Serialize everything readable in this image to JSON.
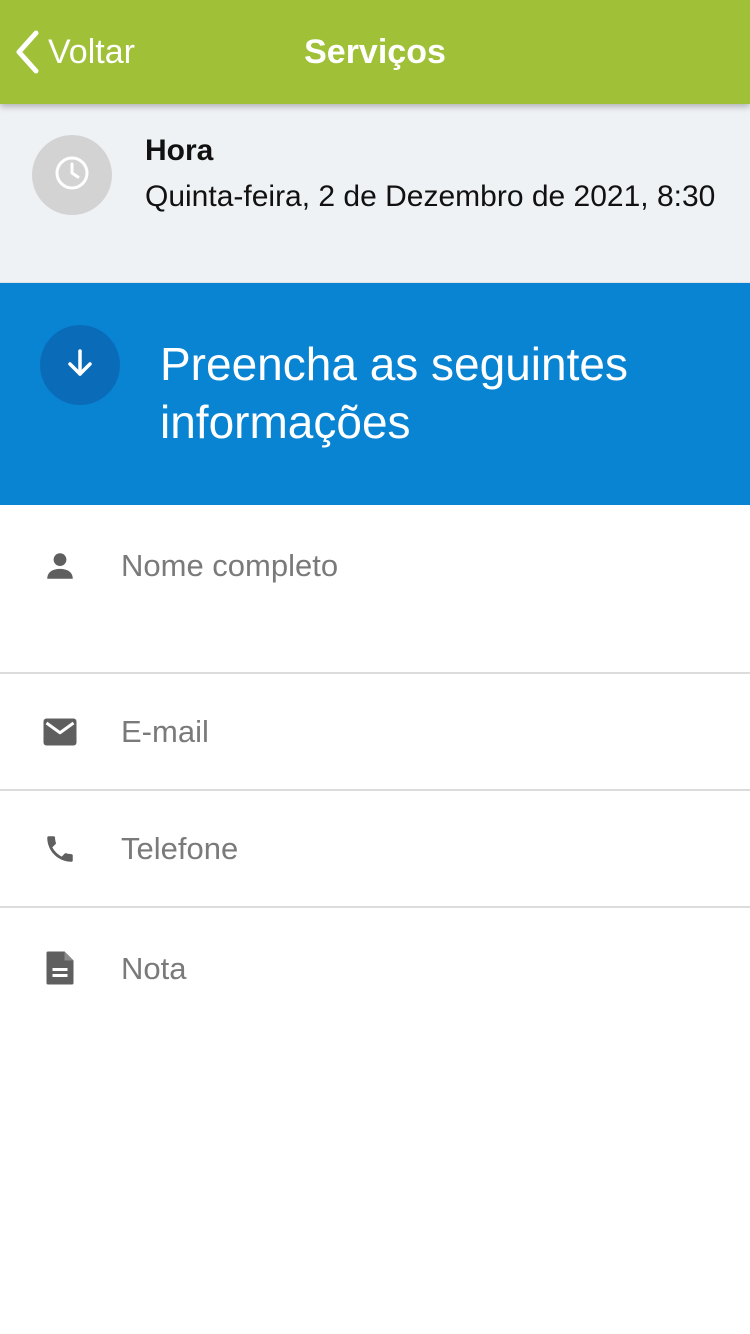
{
  "navbar": {
    "back_label": "Voltar",
    "title": "Serviços",
    "background_color": "#9fc037"
  },
  "time_section": {
    "icon": "clock-icon",
    "label": "Hora",
    "value": "Quinta-feira, 2 de Dezembro de 2021, 8:30"
  },
  "info_header": {
    "icon": "arrow-down-icon",
    "title": "Preencha as seguintes informações",
    "background_color": "#0884d2"
  },
  "form": {
    "fields": [
      {
        "icon": "person-icon",
        "placeholder": "Nome completo"
      },
      {
        "icon": "mail-icon",
        "placeholder": "E-mail"
      },
      {
        "icon": "phone-icon",
        "placeholder": "Telefone"
      },
      {
        "icon": "note-icon",
        "placeholder": "Nota"
      }
    ]
  }
}
